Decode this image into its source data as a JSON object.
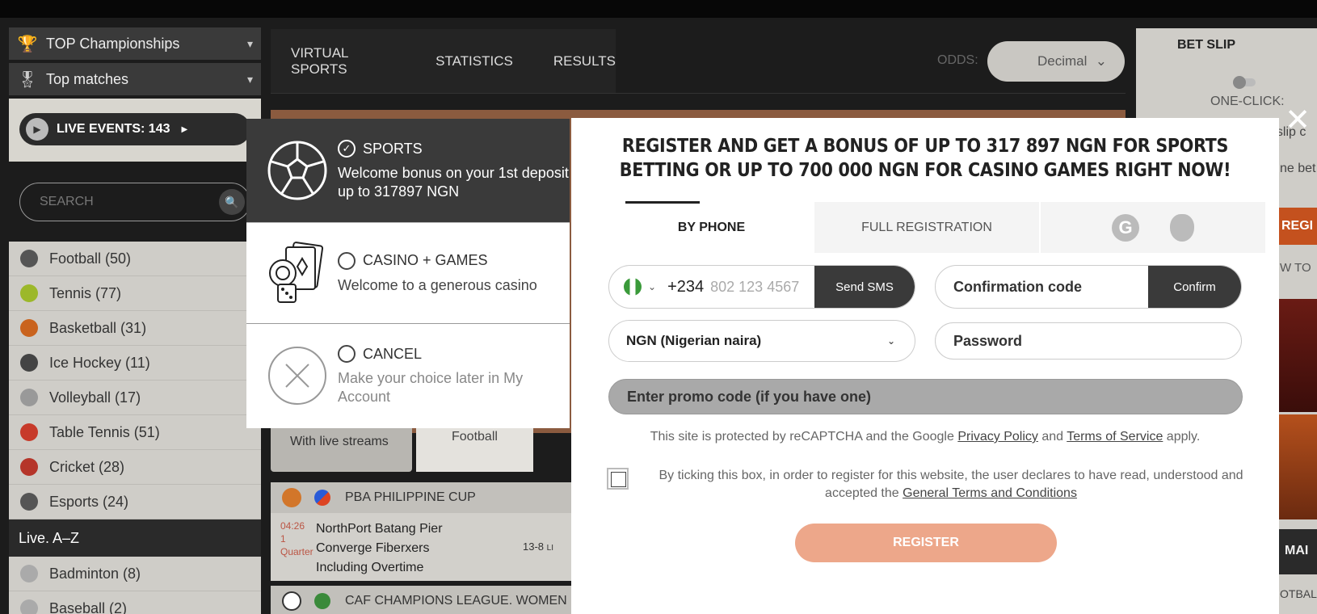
{
  "sidebar": {
    "top_championships": "TOP Championships",
    "top_matches": "Top matches",
    "live_events": "LIVE EVENTS: 143",
    "search_placeholder": "SEARCH",
    "sports": [
      {
        "name": "Football (50)",
        "color": "#555555"
      },
      {
        "name": "Tennis (77)",
        "color": "#9cb82a"
      },
      {
        "name": "Basketball (31)",
        "color": "#c9631e"
      },
      {
        "name": "Ice Hockey (11)",
        "color": "#444444"
      },
      {
        "name": "Volleyball (17)",
        "color": "#999999"
      },
      {
        "name": "Table Tennis (51)",
        "color": "#c73a2a"
      },
      {
        "name": "Cricket (28)",
        "color": "#b5352a"
      },
      {
        "name": "Esports (24)",
        "color": "#555555"
      }
    ],
    "az_header": "Live. A–Z",
    "az_items": [
      {
        "name": "Badminton (8)",
        "color": "#aaaaaa"
      },
      {
        "name": "Baseball (2)",
        "color": "#aaaaaa"
      }
    ]
  },
  "nav": {
    "items": [
      "VIRTUAL SPORTS",
      "STATISTICS",
      "RESULTS"
    ],
    "odds_label": "ODDS:",
    "odds_value": "Decimal"
  },
  "center": {
    "tab_streams": "With live streams",
    "tab_football": "Football",
    "match1": {
      "league": "PBA PHILIPPINE CUP",
      "time": "04:26",
      "period_num": "1",
      "period": "Quarter",
      "team1": "NorthPort Batang Pier",
      "team2": "Converge Fiberxers",
      "note": "Including Overtime",
      "score": "13-8",
      "score_suffix": "LI"
    },
    "match2_league": "CAF CHAMPIONS LEAGUE. WOMEN"
  },
  "betslip": {
    "title": "BET SLIP",
    "one_click": "ONE-CLICK:",
    "frag1": "t slip c",
    "frag2": "ne bet",
    "reg": "REGI",
    "frag3": "W TO",
    "mai": "MAI",
    "frag4": "OTBALL"
  },
  "bonus": {
    "sports": {
      "title": "SPORTS",
      "desc": "Welcome bonus on your 1st deposit up to 317897 NGN"
    },
    "casino": {
      "title": "CASINO + GAMES",
      "desc": "Welcome to a generous casino"
    },
    "cancel": {
      "title": "CANCEL",
      "desc": "Make your choice later in My Account"
    }
  },
  "register": {
    "title": "REGISTER AND GET A BONUS OF UP TO 317 897 NGN FOR SPORTS BETTING OR UP TO 700 000 NGN FOR CASINO GAMES RIGHT NOW!",
    "tab_phone": "BY PHONE",
    "tab_full": "FULL REGISTRATION",
    "google_letter": "G",
    "phone_code": "+234",
    "phone_placeholder": "802 123 4567",
    "send_sms": "Send SMS",
    "confirmation_placeholder": "Confirmation code",
    "confirm": "Confirm",
    "currency": "NGN (Nigerian naira)",
    "password_placeholder": "Password",
    "promo_placeholder": "Enter promo code (if you have one)",
    "recaptcha_pre": "This site is protected by reCAPTCHA and the Google ",
    "privacy": "Privacy Policy",
    "and": " and ",
    "tos": "Terms of Service",
    "apply": " apply.",
    "terms_pre": "By ticking this box, in order to register for this website, the user declares to have read, understood and accepted the ",
    "terms_link": "General Terms and Conditions",
    "register_btn": "REGISTER"
  }
}
